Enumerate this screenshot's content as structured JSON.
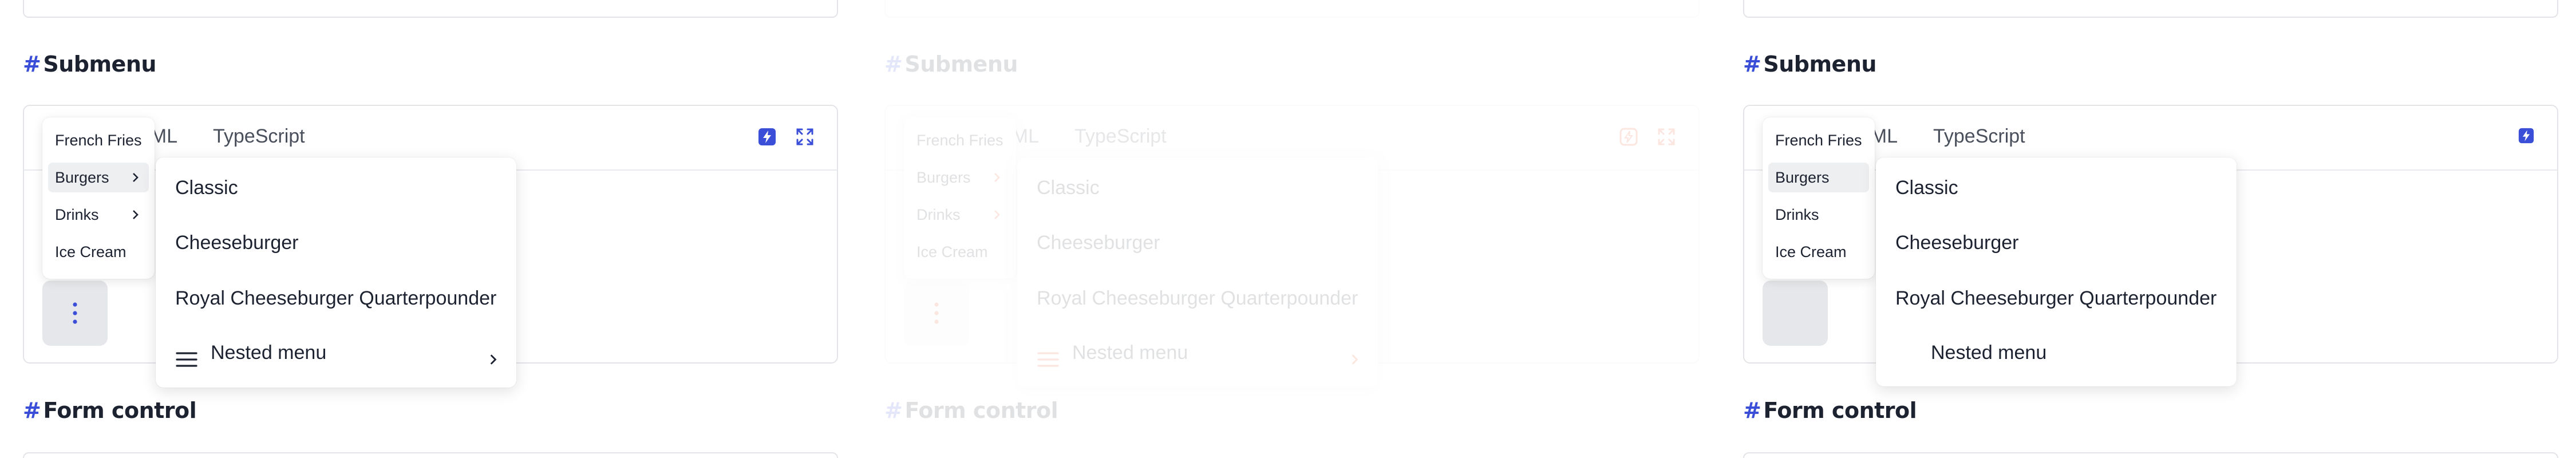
{
  "sections": {
    "submenu_title": "Submenu",
    "form_control_title": "Form control",
    "hash": "#"
  },
  "tabs": {
    "html": "TML",
    "typescript": "TypeScript"
  },
  "mini_menu": {
    "items": [
      "French Fries",
      "Burgers",
      "Drinks",
      "Ice Cream"
    ]
  },
  "submenu": {
    "items": [
      "Classic",
      "Cheeseburger",
      "Royal Cheeseburger Quarterpounder",
      "Nested menu"
    ]
  },
  "colors": {
    "accent_blue": "#3a4ed8",
    "accent_orange": "#e8461a",
    "text_dark": "#1d2231",
    "border": "#e2e4e8"
  },
  "icons": {
    "toolbar": [
      "stackblitz-icon",
      "expand-icon"
    ],
    "kebab": "vertical-dots-icon",
    "nested": "menu-lines-icon",
    "chevron": "chevron-right-icon"
  }
}
